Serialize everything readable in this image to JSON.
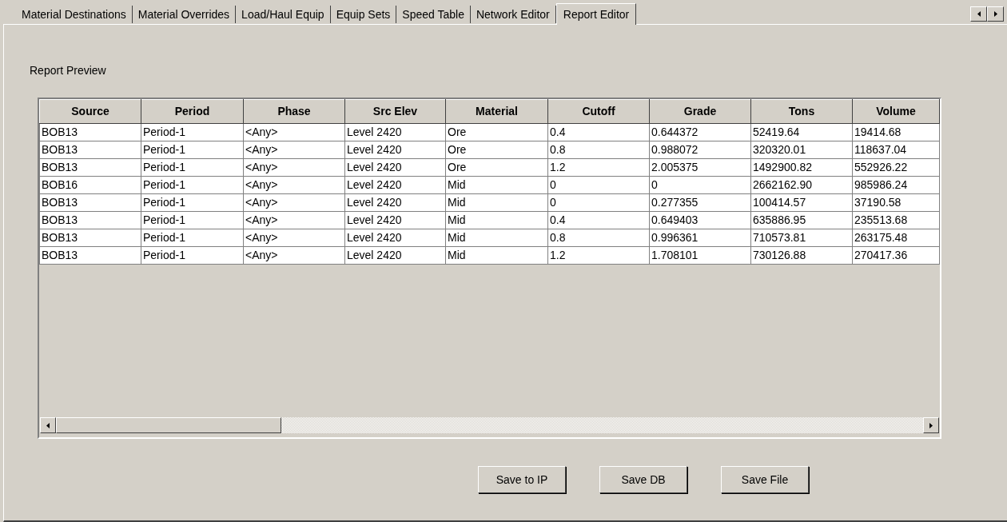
{
  "tabs": [
    {
      "label": "Material Destinations",
      "selected": false
    },
    {
      "label": "Material Overrides",
      "selected": false
    },
    {
      "label": "Load/Haul Equip",
      "selected": false
    },
    {
      "label": "Equip Sets",
      "selected": false
    },
    {
      "label": "Speed Table",
      "selected": false
    },
    {
      "label": "Network Editor",
      "selected": false
    },
    {
      "label": "Report Editor",
      "selected": true
    }
  ],
  "panel": {
    "title": "Report Preview"
  },
  "table": {
    "columns": [
      "Source",
      "Period",
      "Phase",
      "Src Elev",
      "Material",
      "Cutoff",
      "Grade",
      "Tons",
      "Volume"
    ],
    "rows": [
      [
        "BOB13",
        "Period-1",
        "<Any>",
        "Level 2420",
        "Ore",
        "0.4",
        "0.644372",
        "52419.64",
        "19414.68"
      ],
      [
        "BOB13",
        "Period-1",
        "<Any>",
        "Level 2420",
        "Ore",
        "0.8",
        "0.988072",
        "320320.01",
        "118637.04"
      ],
      [
        "BOB13",
        "Period-1",
        "<Any>",
        "Level 2420",
        "Ore",
        "1.2",
        "2.005375",
        "1492900.82",
        "552926.22"
      ],
      [
        "BOB16",
        "Period-1",
        "<Any>",
        "Level 2420",
        "Mid",
        "0",
        "0",
        "2662162.90",
        "985986.24"
      ],
      [
        "BOB13",
        "Period-1",
        "<Any>",
        "Level 2420",
        "Mid",
        "0",
        "0.277355",
        "100414.57",
        "37190.58"
      ],
      [
        "BOB13",
        "Period-1",
        "<Any>",
        "Level 2420",
        "Mid",
        "0.4",
        "0.649403",
        "635886.95",
        "235513.68"
      ],
      [
        "BOB13",
        "Period-1",
        "<Any>",
        "Level 2420",
        "Mid",
        "0.8",
        "0.996361",
        "710573.81",
        "263175.48"
      ],
      [
        "BOB13",
        "Period-1",
        "<Any>",
        "Level 2420",
        "Mid",
        "1.2",
        "1.708101",
        "730126.88",
        "270417.36"
      ]
    ]
  },
  "buttons": [
    "Save to IP",
    "Save DB",
    "Save File"
  ]
}
